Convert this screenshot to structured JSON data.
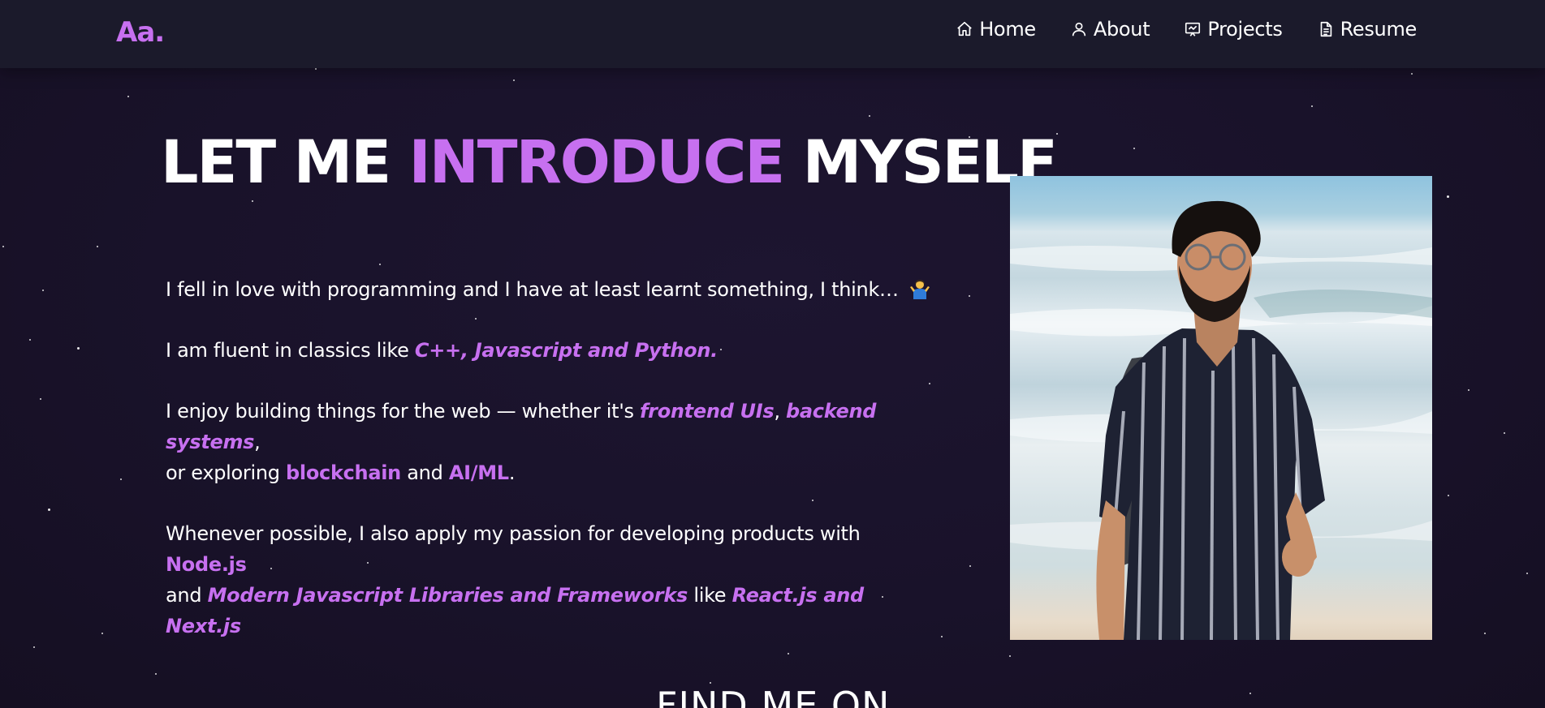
{
  "navbar": {
    "logo": "Aa.",
    "items": [
      {
        "label": "Home",
        "icon": "home-icon"
      },
      {
        "label": "About",
        "icon": "user-icon"
      },
      {
        "label": "Projects",
        "icon": "projects-icon"
      },
      {
        "label": "Resume",
        "icon": "document-icon"
      }
    ]
  },
  "intro": {
    "heading": {
      "part1": "LET ME ",
      "highlight": "INTRODUCE",
      "part2": " MYSELF"
    },
    "para1": {
      "text": "I fell in love with programming and I have at least learnt something, I think… ",
      "emoji": "person-shrugging-emoji"
    },
    "para2": {
      "text": "I am fluent in classics like ",
      "languages": "C++, Javascript and Python."
    },
    "para3": {
      "t1": "I enjoy building things for the web — whether it's ",
      "frontend": "frontend UIs",
      "sep": ", ",
      "backend": "backend systems",
      "t2": ",",
      "t3": "or exploring ",
      "blockchain": "blockchain",
      "and": " and ",
      "aiml": "AI/ML",
      "end": "."
    },
    "para4": {
      "t1": "Whenever possible, I also apply my passion for developing products with ",
      "node": "Node.js",
      "t2": "and ",
      "libs": "Modern Javascript Libraries and Frameworks",
      "like": " like ",
      "react": "React.js and Next.js"
    }
  },
  "photo": {
    "subject": "profile-photo"
  },
  "find_me": {
    "title": "FIND ME ON"
  },
  "colors": {
    "accent": "#c770f0",
    "background": "#1b1327",
    "navbar": "#1b1a2b",
    "text": "#ffffff"
  }
}
